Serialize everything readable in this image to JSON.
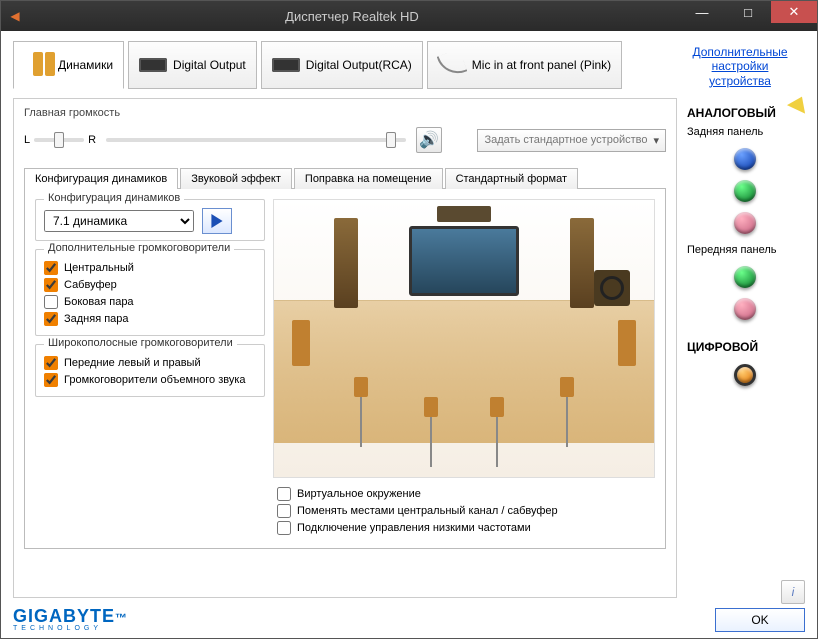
{
  "window": {
    "title": "Диспетчер Realtek HD"
  },
  "tabs": {
    "speakers": "Динамики",
    "digital": "Digital Output",
    "digital_rca": "Digital Output(RCA)",
    "mic": "Mic in at front panel (Pink)"
  },
  "adv_link": "Дополнительные настройки устройства",
  "volume": {
    "legend": "Главная громкость",
    "L": "L",
    "R": "R",
    "default_btn": "Задать стандартное устройство"
  },
  "subtabs": {
    "cfg": "Конфигурация динамиков",
    "fx": "Звуковой эффект",
    "room": "Поправка на помещение",
    "fmt": "Стандартный формат"
  },
  "cfg": {
    "group_label": "Конфигурация динамиков",
    "select_value": "7.1 динамика"
  },
  "optional": {
    "group_label": "Дополнительные громкоговорители",
    "center": "Центральный",
    "sub": "Сабвуфер",
    "side": "Боковая пара",
    "rear": "Задняя пара"
  },
  "fullrange": {
    "group_label": "Широкополосные громкоговорители",
    "front": "Передние левый и правый",
    "surround": "Громкоговорители объемного звука"
  },
  "roomchk": {
    "virtual": "Виртуальное окружение",
    "swap": "Поменять местами центральный канал / сабвуфер",
    "bass": "Подключение управления низкими частотами"
  },
  "right": {
    "analog": "АНАЛОГОВЫЙ",
    "rear": "Задняя панель",
    "front": "Передняя панель",
    "digital": "ЦИФРОВОЙ"
  },
  "brand": {
    "name": "GIGABYTE",
    "sub": "TECHNOLOGY"
  },
  "ok": "OK"
}
